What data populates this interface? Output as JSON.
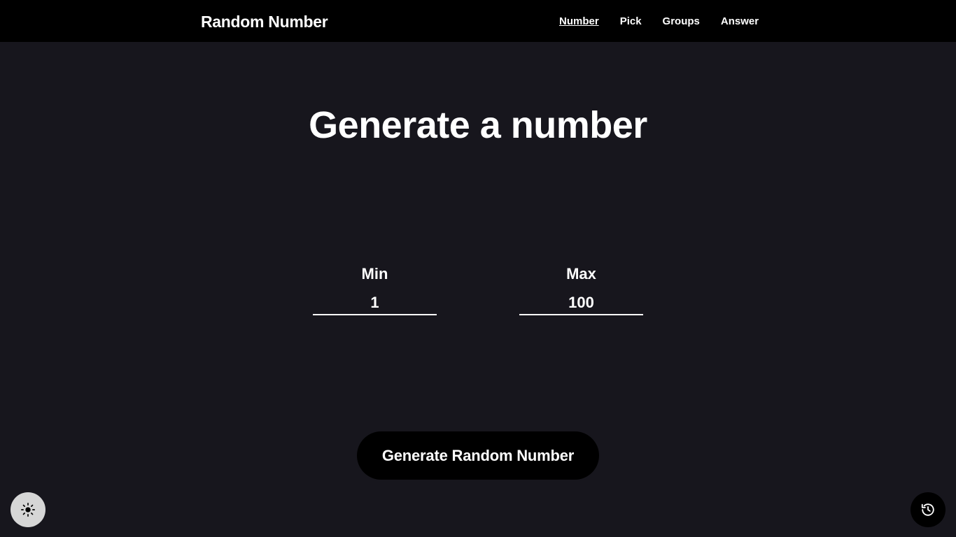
{
  "navbar": {
    "brand": "Random Number",
    "links": [
      {
        "label": "Number",
        "active": true
      },
      {
        "label": "Pick",
        "active": false
      },
      {
        "label": "Groups",
        "active": false
      },
      {
        "label": "Answer",
        "active": false
      }
    ]
  },
  "main": {
    "title": "Generate a number",
    "min": {
      "label": "Min",
      "value": "1"
    },
    "max": {
      "label": "Max",
      "value": "100"
    },
    "generate_label": "Generate Random Number"
  },
  "controls": {
    "theme_toggle_icon": "sun-icon",
    "history_icon": "history-icon"
  },
  "colors": {
    "background": "#17161d",
    "navbar": "#000000",
    "text": "#ffffff",
    "button": "#000000",
    "theme_toggle": "#d6d6d6"
  }
}
